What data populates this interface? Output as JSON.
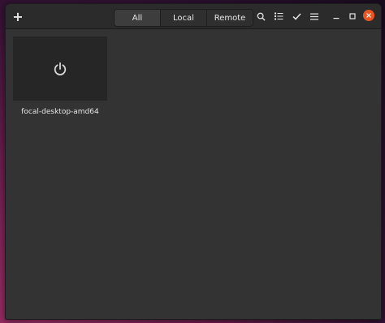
{
  "header": {
    "tabs": [
      {
        "label": "All",
        "active": true
      },
      {
        "label": "Local",
        "active": false
      },
      {
        "label": "Remote",
        "active": false
      }
    ],
    "icons": [
      "plus-icon",
      "search-icon",
      "list-view-icon",
      "select-checkmark-icon",
      "hamburger-menu-icon",
      "minimize-icon",
      "maximize-icon",
      "close-icon"
    ]
  },
  "machines": [
    {
      "name": "focal-desktop-amd64",
      "state_icon": "power-icon"
    }
  ],
  "colors": {
    "accent_close": "#e95420",
    "window_bg": "#333333",
    "headerbar_bg": "#2b2b2b",
    "thumbnail_bg": "#262626"
  }
}
